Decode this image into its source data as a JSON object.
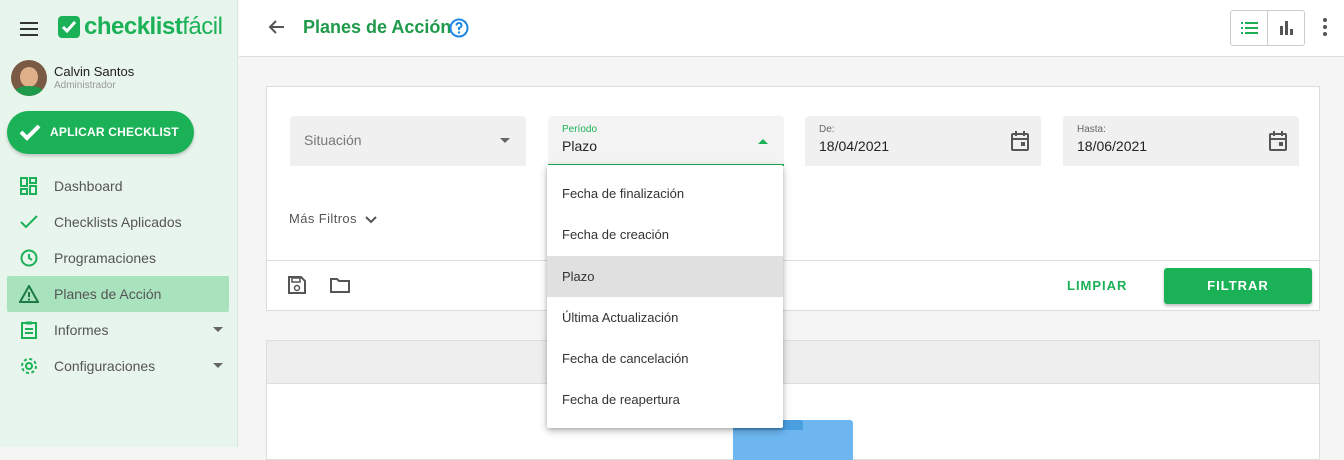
{
  "brand": {
    "name_bold": "checklist",
    "name_light": "fácil"
  },
  "user": {
    "name": "Calvin Santos",
    "role": "Administrador"
  },
  "apply_button": {
    "label": "APLICAR CHECKLIST"
  },
  "nav": [
    {
      "label": "Dashboard",
      "icon": "dashboard-icon",
      "active": false,
      "expandable": false
    },
    {
      "label": "Checklists Aplicados",
      "icon": "check-icon",
      "active": false,
      "expandable": false
    },
    {
      "label": "Programaciones",
      "icon": "clock-icon",
      "active": false,
      "expandable": false
    },
    {
      "label": "Planes de Acción",
      "icon": "warning-icon",
      "active": true,
      "expandable": false
    },
    {
      "label": "Informes",
      "icon": "clipboard-icon",
      "active": false,
      "expandable": true
    },
    {
      "label": "Configuraciones",
      "icon": "gear-icon",
      "active": false,
      "expandable": true
    }
  ],
  "header": {
    "title": "Planes de Acción"
  },
  "filters": {
    "situacion": {
      "placeholder": "Situación"
    },
    "periodo": {
      "label": "Período",
      "value": "Plazo"
    },
    "de": {
      "label": "De:",
      "value": "18/04/2021"
    },
    "hasta": {
      "label": "Hasta:",
      "value": "18/06/2021"
    },
    "more_filters": "Más Filtros",
    "clear_label": "LIMPIAR",
    "filter_label": "FILTRAR"
  },
  "periodo_options": [
    {
      "label": "Fecha de finalización",
      "selected": false
    },
    {
      "label": "Fecha de creación",
      "selected": false
    },
    {
      "label": "Plazo",
      "selected": true
    },
    {
      "label": "Última Actualización",
      "selected": false
    },
    {
      "label": "Fecha de cancelación",
      "selected": false
    },
    {
      "label": "Fecha de reapertura",
      "selected": false
    }
  ],
  "colors": {
    "brand_green": "#1bb157",
    "active_nav": "#a9e3be",
    "sidebar_bg": "#e8f5ec"
  }
}
